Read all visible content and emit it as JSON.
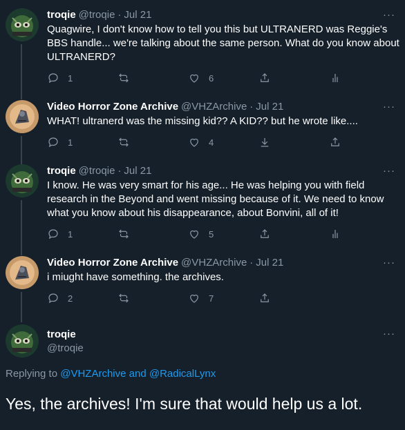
{
  "tweets": [
    {
      "name": "troqie",
      "handle": "@troqie",
      "dot": "·",
      "date": "Jul 21",
      "text": "Quagwire, I don't know how to tell you this but ULTRANERD was Reggie's BBS handle... we're talking about the same person. What do you know about ULTRANERD?",
      "replies": "1",
      "retweets": "",
      "likes": "6",
      "extra": "share-and-analytics"
    },
    {
      "name": "Video Horror Zone Archive",
      "handle": "@VHZArchive",
      "dot": "·",
      "date": "Jul 21",
      "text": "WHAT! ultranerd was the missing kid?? A KID?? but he wrote like....",
      "replies": "1",
      "retweets": "",
      "likes": "4",
      "extra": "download-and-share"
    },
    {
      "name": "troqie",
      "handle": "@troqie",
      "dot": "·",
      "date": "Jul 21",
      "text": "I know. He was very smart for his age... He was helping you with field research in the Beyond and went missing because of it. We need to know what you know about his disappearance, about Bonvini, all of it!",
      "replies": "1",
      "retweets": "",
      "likes": "5",
      "extra": "share-and-analytics"
    },
    {
      "name": "Video Horror Zone Archive",
      "handle": "@VHZArchive",
      "dot": "·",
      "date": "Jul 21",
      "text": "i miught have something. the archives.",
      "replies": "2",
      "retweets": "",
      "likes": "7",
      "extra": "share"
    }
  ],
  "focus": {
    "name": "troqie",
    "handle": "@troqie",
    "replying_prefix": "Replying to ",
    "replying_user1": "@VHZArchive",
    "replying_and": " and ",
    "replying_user2": "@RadicalLynx",
    "text": "Yes, the archives! I'm sure that would help us a lot."
  },
  "more_label": "···",
  "colors": {
    "background": "#15202b",
    "text": "#ffffff",
    "muted": "#8b98a5",
    "link": "#1d9bf0",
    "thread_line": "#38444d"
  },
  "icons": [
    "reply-icon",
    "retweet-icon",
    "like-icon",
    "share-icon",
    "analytics-icon",
    "download-icon",
    "more-icon"
  ]
}
